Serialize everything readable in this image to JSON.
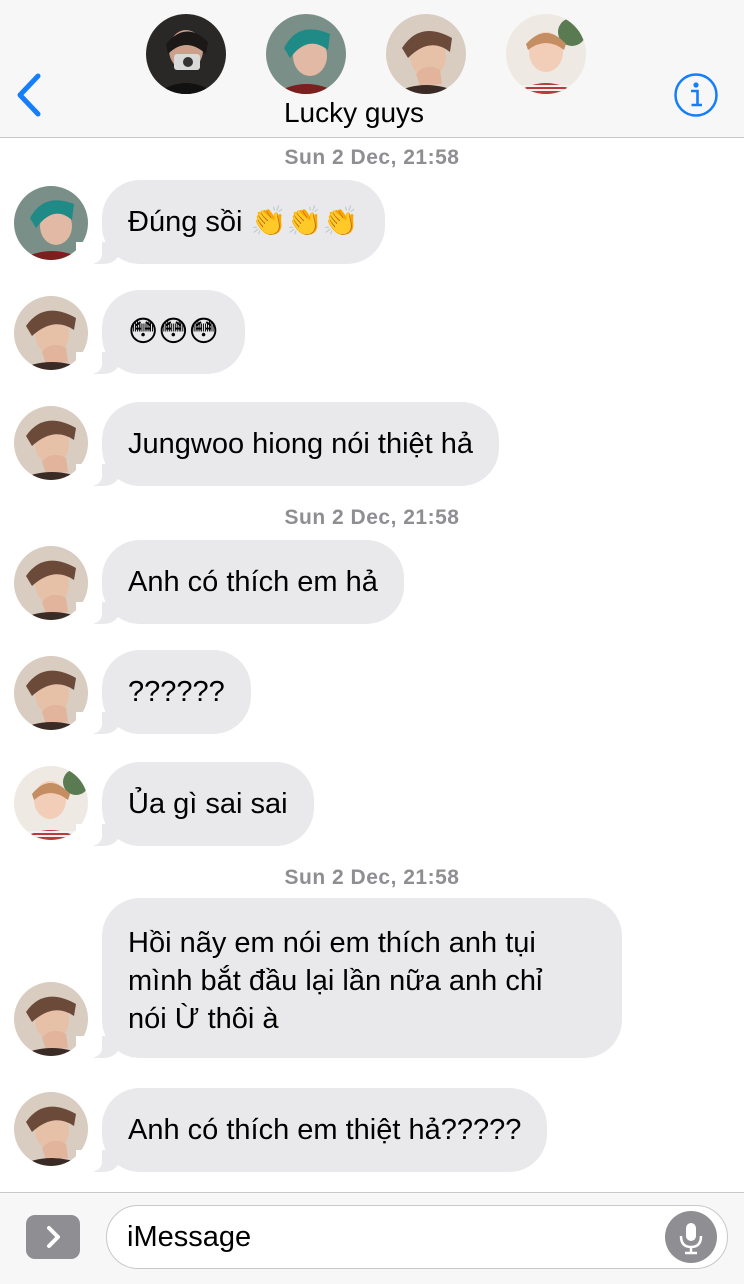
{
  "header": {
    "group_name": "Lucky guys",
    "back_icon": "chevron-left-icon",
    "info_icon": "info-circle-icon",
    "accent_color": "#157efb"
  },
  "conversation": {
    "timestamps": [
      "Sun 2 Dec, 21:58",
      "Sun 2 Dec, 21:58",
      "Sun 2 Dec, 21:58"
    ],
    "messages": [
      {
        "text": "Đúng sồi 👏👏👏"
      },
      {
        "text": "😳😳😳"
      },
      {
        "text": "Jungwoo hiong nói thiệt hả"
      },
      {
        "text": "Anh có thích em hả"
      },
      {
        "text": "??????"
      },
      {
        "text": "Ủa gì sai sai"
      },
      {
        "lines": [
          "Hồi nãy em nói em thích anh tụi",
          "mình bắt đầu lại lần nữa anh chỉ",
          "nói Ừ thôi à"
        ]
      },
      {
        "text": "Anh có thích em thiệt hả?????"
      }
    ]
  },
  "input_bar": {
    "placeholder": "iMessage",
    "apps_icon": "chevron-right-icon",
    "mic_icon": "microphone-icon"
  },
  "colors": {
    "bubble_gray": "#e9e9eb",
    "timestamp_gray": "#8e8e93",
    "header_bg": "#f7f7f7"
  }
}
